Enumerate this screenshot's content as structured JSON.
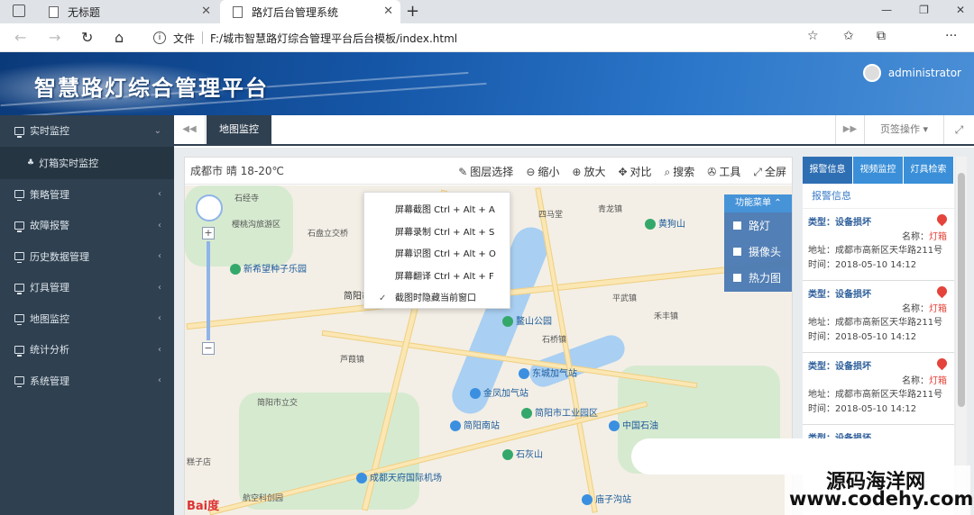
{
  "browser": {
    "tab1_title": "无标题",
    "tab2_title": "路灯后台管理系统",
    "address_label": "文件",
    "url": "F:/城市智慧路灯综合管理平台后台模板/index.html"
  },
  "header": {
    "app_title": "智慧路灯综合管理平台",
    "username": "administrator"
  },
  "sidebar": {
    "items": [
      {
        "label": "实时监控",
        "icon": "monitor-icon"
      },
      {
        "label": "灯箱实时监控",
        "icon": "sitemap-icon"
      },
      {
        "label": "策略管理",
        "icon": "monitor-icon"
      },
      {
        "label": "故障报警",
        "icon": "monitor-icon"
      },
      {
        "label": "历史数据管理",
        "icon": "monitor-icon"
      },
      {
        "label": "灯具管理",
        "icon": "monitor-icon"
      },
      {
        "label": "地图监控",
        "icon": "monitor-icon"
      },
      {
        "label": "统计分析",
        "icon": "monitor-icon"
      },
      {
        "label": "系统管理",
        "icon": "monitor-icon"
      }
    ]
  },
  "tabs": {
    "active": "地图监控",
    "page_ops": "页签操作"
  },
  "map": {
    "weather": "成都市 晴 18-20℃",
    "tools": [
      "图层选择",
      "缩小",
      "放大",
      "对比",
      "搜索",
      "工具",
      "全屏"
    ],
    "context_menu": [
      "屏幕截图 Ctrl + Alt + A",
      "屏幕录制 Ctrl + Alt + S",
      "屏幕识图 Ctrl + Alt + O",
      "屏幕翻译 Ctrl + Alt + F",
      "截图时隐藏当前窗口"
    ],
    "function_menu": {
      "header": "功能菜单",
      "options": [
        "路灯",
        "摄像头",
        "热力图"
      ]
    },
    "labels": {
      "l1": "石经寺",
      "l2": "樱桃沟旅游区",
      "l3": "石盘立交桥",
      "l4": "四马堂",
      "l5": "青龙镇",
      "l6": "黄狗山",
      "l7": "新希望种子乐园",
      "l8": "简阳市",
      "l9": "鳌山公园",
      "l10": "东城加气站",
      "l11": "金凤加气站",
      "l12": "简阳市工业园区",
      "l13": "简阳南站",
      "l14": "中国石油",
      "l15": "简阳市立交",
      "l16": "成都天府国际机场",
      "l17": "航空科创园",
      "l18": "芦葭镇",
      "l19": "禾丰镇",
      "l20": "平武镇",
      "l21": "石桥镇",
      "l22": "庙子沟站",
      "l23": "石灰山",
      "l24": "糕子店"
    },
    "logo": "Bai度"
  },
  "right_panel": {
    "tabs": [
      "报警信息",
      "视频监控",
      "灯具检索"
    ],
    "subtitle": "报警信息",
    "alarms": [
      {
        "type": "类型：设备损坏",
        "name_label": "名称：",
        "name": "灯箱",
        "addr": "地址：成都市高新区天华路211号",
        "time": "时间：2018-05-10 14:12"
      },
      {
        "type": "类型：设备损坏",
        "name_label": "名称：",
        "name": "灯箱",
        "addr": "地址：成都市高新区天华路211号",
        "time": "时间：2018-05-10 14:12"
      },
      {
        "type": "类型：设备损坏",
        "name_label": "名称：",
        "name": "灯箱",
        "addr": "地址：成都市高新区天华路211号",
        "time": "时间：2018-05-10 14:12"
      },
      {
        "type": "类型：设备损坏"
      }
    ]
  },
  "watermark": {
    "line1": "源码海洋网",
    "line2": "www.codehy.com"
  }
}
